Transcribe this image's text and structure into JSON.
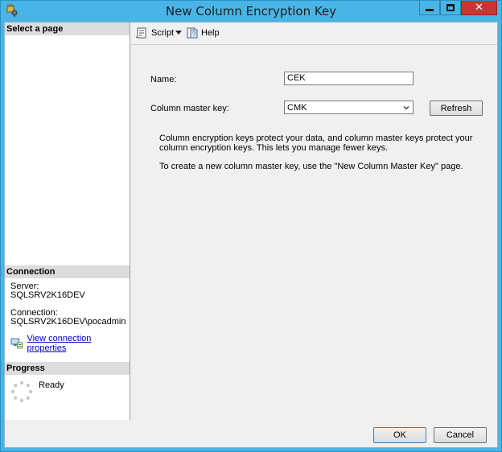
{
  "window": {
    "title": "New Column Encryption Key",
    "close_glyph": "✕"
  },
  "left_pane": {
    "select_page_header": "Select a page",
    "connection_header": "Connection",
    "server_label": "Server:",
    "server_value": "SQLSRV2K16DEV",
    "connection_label": "Connection:",
    "connection_value": "SQLSRV2K16DEV\\pocadmin",
    "view_connection_link": "View connection properties",
    "progress_header": "Progress",
    "progress_status": "Ready"
  },
  "toolbar": {
    "script_label": "Script",
    "help_label": "Help"
  },
  "form": {
    "name_label": "Name:",
    "name_value": "CEK",
    "cmk_label": "Column master key:",
    "cmk_value": "CMK",
    "refresh_label": "Refresh",
    "description_1": "Column encryption keys protect your data, and column master keys protect your column encryption keys. This lets you manage fewer keys.",
    "description_2": "To create a new column master key, use the \"New Column Master Key\" page."
  },
  "buttons": {
    "ok_label": "OK",
    "cancel_label": "Cancel"
  },
  "icons": {
    "app": "database-key-icon",
    "script": "script-icon",
    "help": "help-icon",
    "connection": "connection-properties-icon",
    "spinner": "progress-spinner-icon",
    "dropdown": "chevron-down-icon"
  },
  "colors": {
    "title_bar": "#49b5e6",
    "close_button": "#c7372f",
    "link": "#0000cc",
    "section_header": "#dcdcdc"
  }
}
